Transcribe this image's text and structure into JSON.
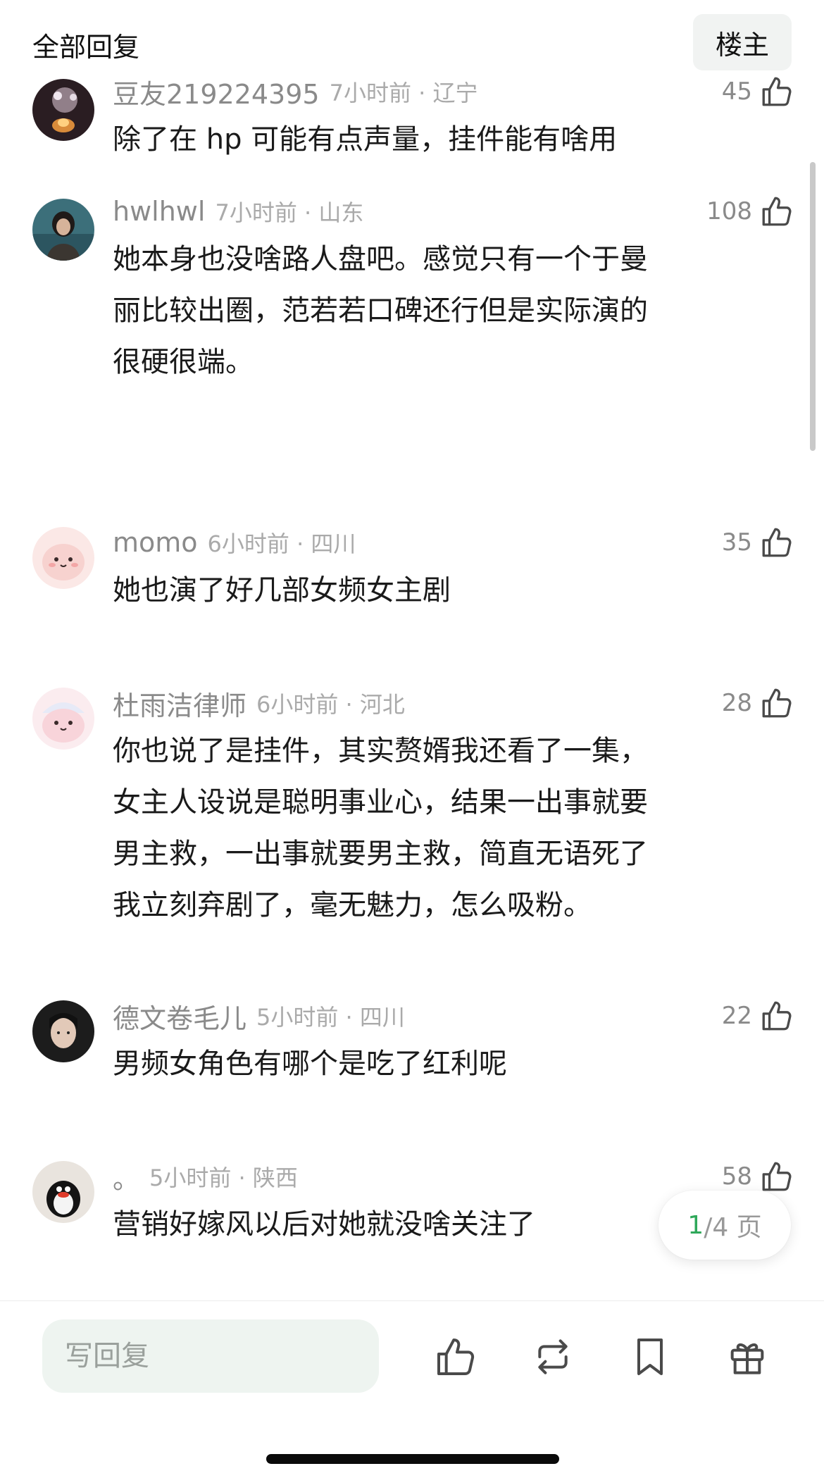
{
  "header": {
    "title": "全部回复",
    "owner_button": "楼主"
  },
  "comments": [
    {
      "author": "豆友219224395",
      "time": "7小时前 · 辽宁",
      "likes": "45",
      "text": "除了在 hp 可能有点声量，挂件能有啥用",
      "avatar": "dark-lantern-avatar"
    },
    {
      "author": "hwlhwl",
      "time": "7小时前 · 山东",
      "likes": "108",
      "text": "她本身也没啥路人盘吧。感觉只有一个于曼\n丽比较出圈，范若若口碑还行但是实际演的\n很硬很端。",
      "avatar": "person-sea-avatar"
    },
    {
      "author": "momo",
      "time": "6小时前 · 四川",
      "likes": "35",
      "text": "她也演了好几部女频女主剧",
      "avatar": "pink-cartoon-avatar"
    },
    {
      "author": "杜雨洁律师",
      "time": "6小时前 · 河北",
      "likes": "28",
      "text": "你也说了是挂件，其实赘婿我还看了一集，\n女主人设说是聪明事业心，结果一出事就要\n男主救，一出事就要男主救，简直无语死了\n我立刻弃剧了，毫无魅力，怎么吸粉。",
      "avatar": "pink-cartoon-hat-avatar"
    },
    {
      "author": "德文卷毛儿",
      "time": "5小时前 · 四川",
      "likes": "22",
      "text": "男频女角色有哪个是吃了红利呢",
      "avatar": "portrait-avatar"
    },
    {
      "author": "。",
      "time": "5小时前 · 陕西",
      "likes": "58",
      "text": "营销好嫁风以后对她就没啥关注了",
      "avatar": "penguin-avatar"
    }
  ],
  "pager": {
    "current": "1",
    "total_text": "/4 页"
  },
  "bottom_bar": {
    "reply_placeholder": "写回复",
    "icons": [
      "thumbs-up-icon",
      "repost-icon",
      "bookmark-icon",
      "gift-icon"
    ]
  }
}
